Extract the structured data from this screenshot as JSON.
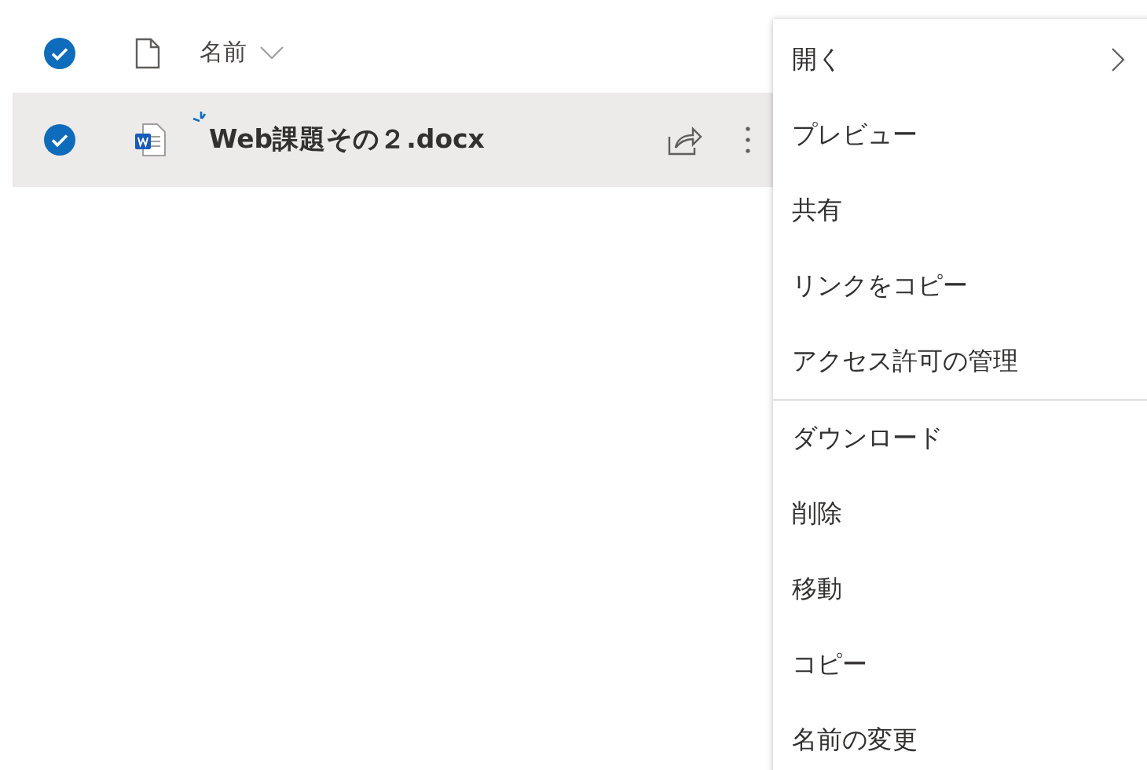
{
  "file_list": {
    "header": {
      "checked": true,
      "column_label": "名前"
    },
    "rows": [
      {
        "name": "Web課題その２.docx",
        "selected": true,
        "checked": true
      }
    ]
  },
  "context_menu": {
    "groups": [
      [
        {
          "label": "開く",
          "has_submenu": true
        },
        {
          "label": "プレビュー",
          "has_submenu": false
        },
        {
          "label": "共有",
          "has_submenu": false
        },
        {
          "label": "リンクをコピー",
          "has_submenu": false
        },
        {
          "label": "アクセス許可の管理",
          "has_submenu": false
        }
      ],
      [
        {
          "label": "ダウンロード",
          "has_submenu": false
        },
        {
          "label": "削除",
          "has_submenu": false
        },
        {
          "label": "移動",
          "has_submenu": false
        },
        {
          "label": "コピー",
          "has_submenu": false
        },
        {
          "label": "名前の変更",
          "has_submenu": false
        }
      ]
    ]
  }
}
